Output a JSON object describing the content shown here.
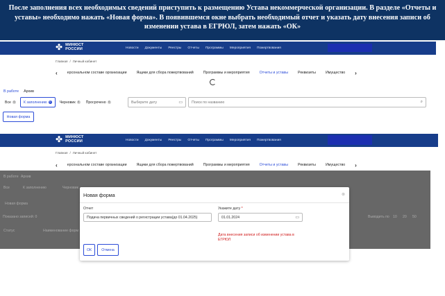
{
  "caption": "После заполнения всех необходимых сведений приступить к размещению Устава некоммерческой организации. В разделе «Отчеты и уставы» необходимо нажать «Новая форма». В появившемся окне выбрать необходимый отчет и указать дату внесения записи об изменении устава в ЕГРЮЛ, затем нажать «ОК»",
  "logo": {
    "line1": "МИНЮСТ",
    "line2": "РОССИИ"
  },
  "nav": [
    "Новости",
    "Документы",
    "Реестры",
    "Отчеты",
    "Программы",
    "Мероприятия",
    "Пожертвования"
  ],
  "breadcrumb": {
    "home": "Главная",
    "sep": "/",
    "current": "Личный кабинет"
  },
  "tabs": [
    "ерсональном составе организации",
    "Ящики для сбора пожертвований",
    "Программы и мероприятия",
    "Отчеты и уставы",
    "Реквизиты",
    "Имущество"
  ],
  "chev_left": "‹",
  "chev_right": "›",
  "subtabs": [
    "В работе",
    "Архив"
  ],
  "filters": [
    {
      "label": "Все",
      "count": "0"
    },
    {
      "label": "К заполнению",
      "count": "0"
    },
    {
      "label": "Черновик",
      "count": "0"
    },
    {
      "label": "Просрочено",
      "count": "0"
    }
  ],
  "date_placeholder": "Выберите дату",
  "search_placeholder": "Поиск по названию",
  "new_form_button": "Новая форма",
  "ghost": {
    "col_status": "Статус",
    "col_name": "Наименование форм",
    "shown": "Показано записей: 0",
    "per_page": "Выводить по",
    "p10": "10",
    "p20": "20",
    "p50": "50"
  },
  "modal": {
    "title": "Новая форма",
    "report_label": "Отчет",
    "report_value": "Подача первичных сведений о регистрации устава(до 01.04.2025)",
    "date_label": "Укажите дату",
    "required_mark": "*",
    "date_value": "01.01.2024",
    "warning": "Дата внесения записи об изменении устава в ЕГРЮЛ",
    "ok": "ОК",
    "cancel": "Отмена"
  },
  "colors": {
    "caption_bg": "#0e3363",
    "nav_bg": "#173d8a",
    "accent": "#2a4bd7",
    "error": "#d01b1b"
  },
  "icons": {
    "logo": "eagle-emblem-icon",
    "calendar": "calendar-icon",
    "search": "search-icon",
    "close": "close-icon",
    "loading": "loading-spinner-icon"
  }
}
